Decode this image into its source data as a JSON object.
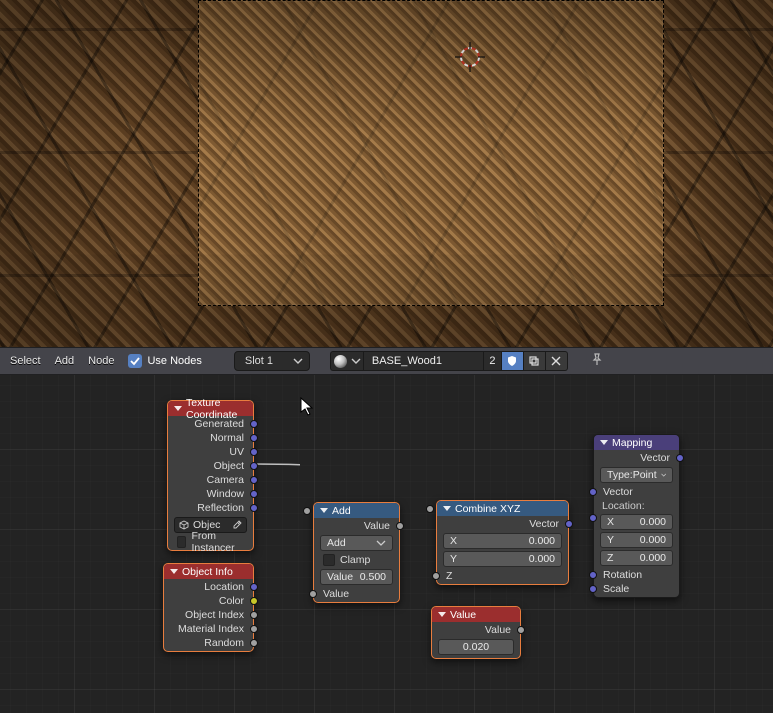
{
  "header": {
    "menu_select": "Select",
    "menu_add": "Add",
    "menu_node": "Node",
    "use_nodes": "Use Nodes",
    "slot": "Slot 1",
    "material_name": "BASE_Wood1",
    "users": "2"
  },
  "nodes": {
    "tex_coord": {
      "title": "Texture Coordinate",
      "outputs": [
        "Generated",
        "Normal",
        "UV",
        "Object",
        "Camera",
        "Window",
        "Reflection"
      ],
      "object_label": "Objec",
      "from_instancer": "From Instancer"
    },
    "obj_info": {
      "title": "Object Info",
      "outputs": [
        "Location",
        "Color",
        "Object Index",
        "Material Index",
        "Random"
      ]
    },
    "add": {
      "title": "Add",
      "out": "Value",
      "mode": "Add",
      "clamp": "Clamp",
      "value_label": "Value",
      "value_amount": "0.500",
      "in_value": "Value"
    },
    "combine": {
      "title": "Combine XYZ",
      "out": "Vector",
      "x_label": "X",
      "x_val": "0.000",
      "y_label": "Y",
      "y_val": "0.000",
      "z_label": "Z"
    },
    "value": {
      "title": "Value",
      "out": "Value",
      "amount": "0.020"
    },
    "mapping": {
      "title": "Mapping",
      "out": "Vector",
      "type_label": "Type:",
      "type_value": "Point",
      "in_vector": "Vector",
      "loc_label": "Location:",
      "x_label": "X",
      "x_val": "0.000",
      "y_label": "Y",
      "y_val": "0.000",
      "z_label": "Z",
      "z_val": "0.000",
      "rotation": "Rotation",
      "scale": "Scale"
    }
  }
}
